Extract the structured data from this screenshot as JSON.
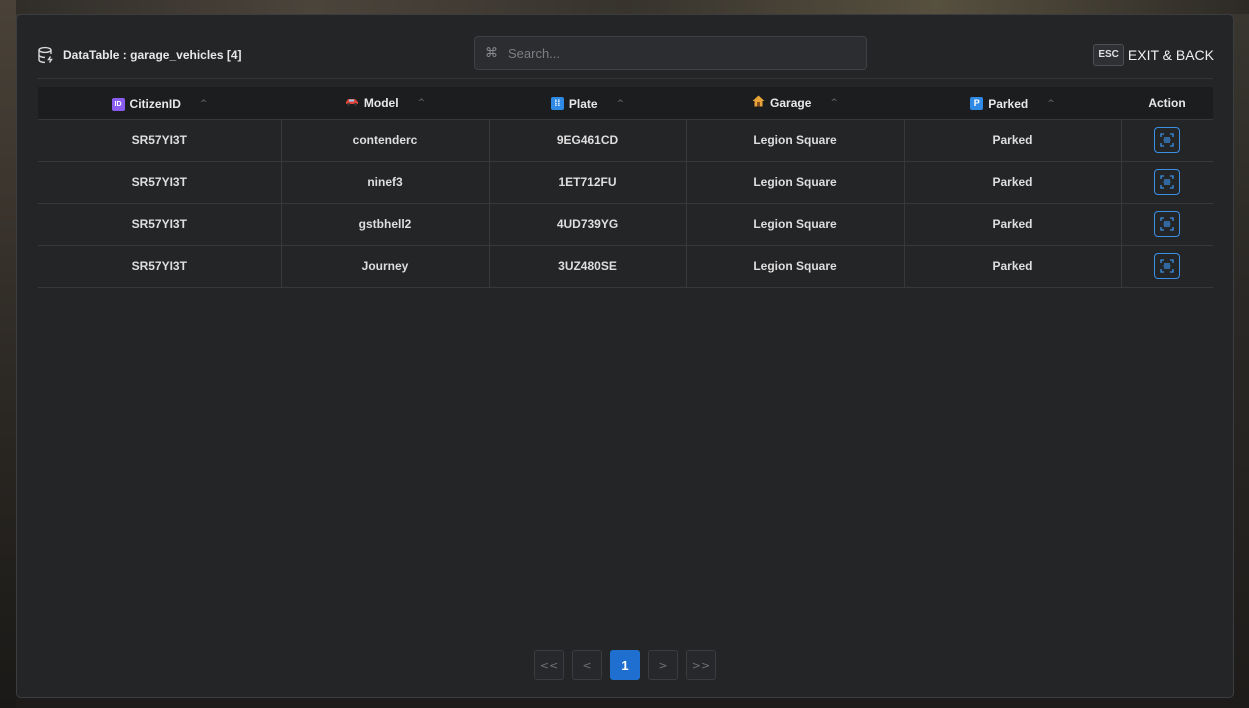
{
  "header": {
    "title": "DataTable : garage_vehicles [4]",
    "search_placeholder": "Search...",
    "esc_key": "ESC",
    "exit_label": "EXIT & BACK"
  },
  "columns": [
    {
      "key": "citizenid",
      "label": "CitizenID",
      "icon": "id-badge-icon"
    },
    {
      "key": "model",
      "label": "Model",
      "icon": "car-icon"
    },
    {
      "key": "plate",
      "label": "Plate",
      "icon": "plate-icon"
    },
    {
      "key": "garage",
      "label": "Garage",
      "icon": "house-icon"
    },
    {
      "key": "parked",
      "label": "Parked",
      "icon": "parking-icon"
    },
    {
      "key": "action",
      "label": "Action"
    }
  ],
  "rows": [
    {
      "citizenid": "SR57YI3T",
      "model": "contenderc",
      "plate": "9EG461CD",
      "garage": "Legion Square",
      "parked": "Parked"
    },
    {
      "citizenid": "SR57YI3T",
      "model": "ninef3",
      "plate": "1ET712FU",
      "garage": "Legion Square",
      "parked": "Parked"
    },
    {
      "citizenid": "SR57YI3T",
      "model": "gstbhell2",
      "plate": "4UD739YG",
      "garage": "Legion Square",
      "parked": "Parked"
    },
    {
      "citizenid": "SR57YI3T",
      "model": "Journey",
      "plate": "3UZ480SE",
      "garage": "Legion Square",
      "parked": "Parked"
    }
  ],
  "pagination": {
    "first": "<<",
    "prev": "<",
    "current_page": "1",
    "next": ">",
    "last": ">>"
  },
  "colors": {
    "accent": "#1f6fd0",
    "panel": "#242527",
    "header_row": "#1c1d1f"
  }
}
